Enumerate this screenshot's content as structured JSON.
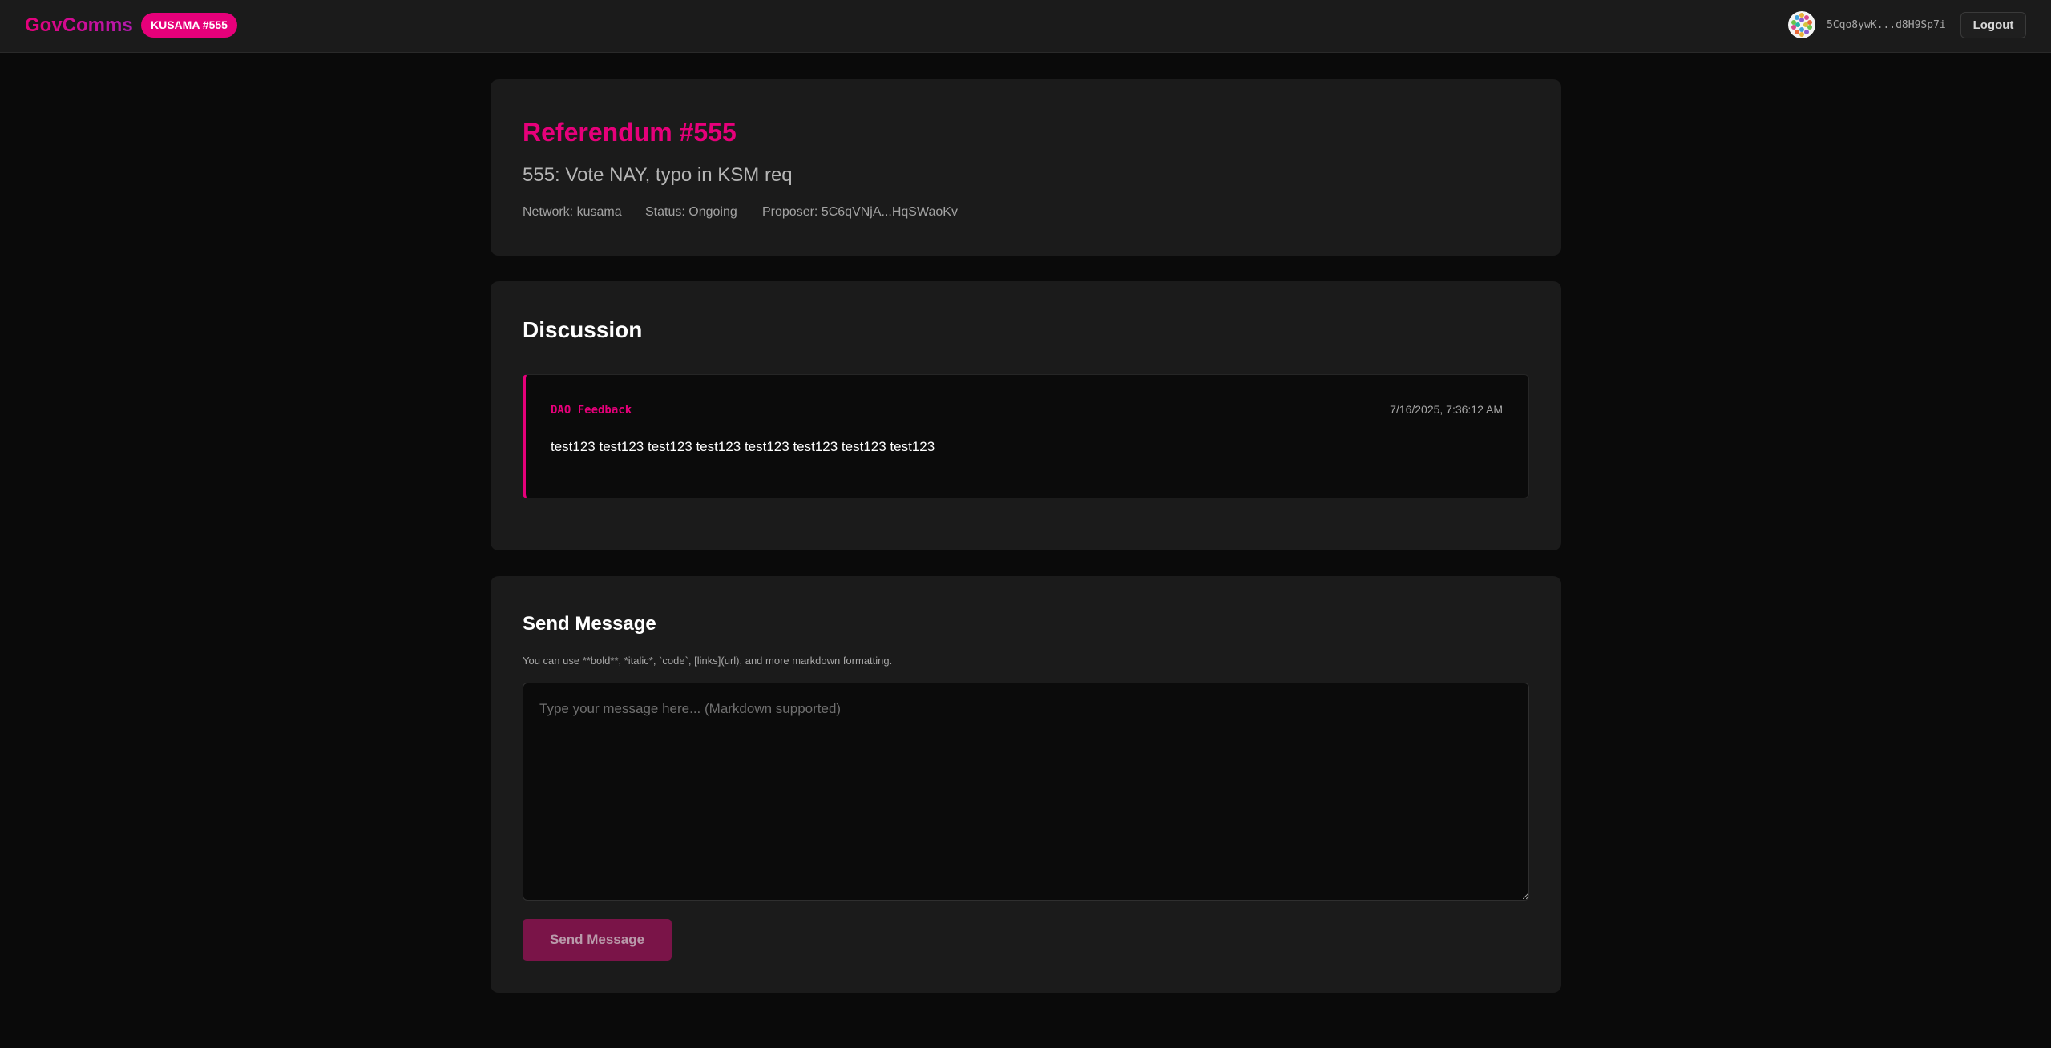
{
  "header": {
    "brand": "GovComms",
    "network_badge": "KUSAMA #555",
    "avatar_icon": "identicon-avatar",
    "address": "5Cqo8ywK...d8H9Sp7i",
    "logout_label": "Logout"
  },
  "referendum": {
    "title": "Referendum #555",
    "subtitle": "555: Vote NAY, typo in KSM req",
    "network": "Network: kusama",
    "status": "Status: Ongoing",
    "proposer": "Proposer: 5C6qVNjA...HqSWaoKv"
  },
  "discussion": {
    "title": "Discussion",
    "messages": [
      {
        "author": "DAO Feedback",
        "timestamp": "7/16/2025, 7:36:12 AM",
        "body": "test123 test123 test123 test123 test123 test123 test123 test123"
      }
    ]
  },
  "send": {
    "title": "Send Message",
    "hint": "You can use **bold**, *italic*, `code`, [links](url), and more markdown formatting.",
    "placeholder": "Type your message here... (Markdown supported)",
    "button_label": "Send Message"
  },
  "colors": {
    "accent": "#e6007a",
    "background": "#0a0a0a",
    "card": "#1b1b1b"
  }
}
